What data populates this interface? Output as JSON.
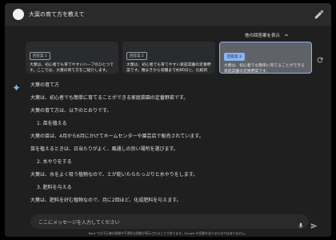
{
  "prompt": {
    "text": "大葉の育て方を教えて"
  },
  "drafts_toggle": {
    "label": "他の回答案を表示"
  },
  "drafts": [
    {
      "badge": "回答案 1",
      "text": "大葉は、初心者でも育てやすいハーブのひとつです。ここでは、大葉の育て方をご紹介します。"
    },
    {
      "badge": "回答案 2",
      "text": "大葉は、初心者でも育てやすい家庭菜園の定番野菜です。種まきから収穫まで約90日と、比較的短い期間で育てることができます。"
    },
    {
      "badge": "回答案 3",
      "text": "大葉は、初心者でも簡単に育てることができる家庭菜園の定番野菜です。"
    }
  ],
  "response": {
    "lines": [
      {
        "text": "大葉の育て方",
        "kind": "para"
      },
      {
        "text": "大葉は、初心者でも簡単に育てることができる家庭菜園の定番野菜です。",
        "kind": "para"
      },
      {
        "text": "大葉の育て方は、以下のとおりです。",
        "kind": "para"
      },
      {
        "text": "1. 苗を植える",
        "kind": "item"
      },
      {
        "text": "大葉の苗は、4月から6月にかけてホームセンターや園芸店で販売されています。",
        "kind": "para"
      },
      {
        "text": "苗を植えるときは、日当たりがよく、風通しの良い場所を選びます。",
        "kind": "para"
      },
      {
        "text": "2. 水やりをする",
        "kind": "item"
      },
      {
        "text": "大葉は、水をよく吸う植物なので、土が乾いたらたっぷりと水やりをします。",
        "kind": "para"
      },
      {
        "text": "3. 肥料を与える",
        "kind": "item"
      },
      {
        "text": "大葉は、肥料を好む植物なので、月に2回ほど、化成肥料を与えます。",
        "kind": "para"
      }
    ]
  },
  "input": {
    "placeholder": "ここにメッセージを入力してください"
  },
  "footer": {
    "text": "Bard では不正確な情報や不適切な情報が表示されることがあります。Google の見解を述べるものではありません。"
  },
  "colors": {
    "background": "#1f1f1f",
    "accent": "#8ab4f8",
    "surface": "#282a2c"
  },
  "icons": {
    "edit": "pencil-icon",
    "expand": "chevron-up-icon",
    "regenerate": "refresh-icon",
    "mic": "mic-icon",
    "send": "send-icon",
    "sparkle": "bard-sparkle-icon"
  }
}
